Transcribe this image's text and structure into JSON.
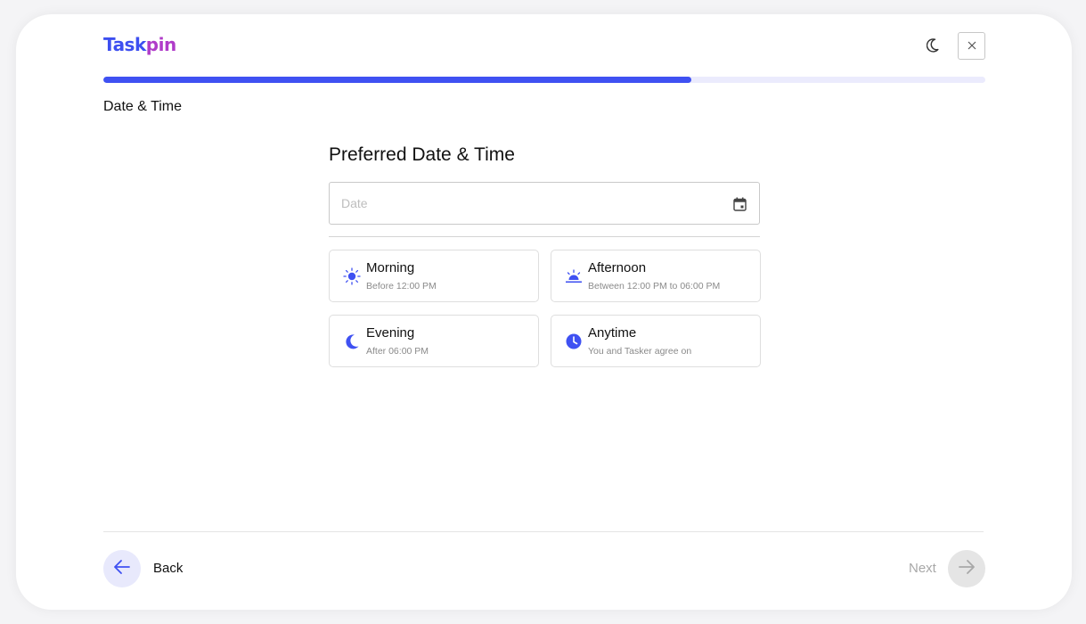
{
  "brand": {
    "logo_part1": "Task",
    "logo_part2": "pin",
    "color1": "#3d4ff0",
    "color2": "#b03cc9"
  },
  "header": {
    "theme_icon": "moon-icon",
    "close_icon": "close-icon"
  },
  "progress": {
    "value_fraction": 0.667,
    "fill_color": "#3f51f2",
    "track_color": "#ebebfd"
  },
  "step": {
    "label": "Date & Time"
  },
  "form": {
    "title": "Preferred Date & Time",
    "date_placeholder": "Date",
    "date_value": "",
    "calendar_icon": "calendar-icon"
  },
  "time_options": [
    {
      "title": "Morning",
      "subtitle": "Before 12:00 PM",
      "icon": "sun-icon"
    },
    {
      "title": "Afternoon",
      "subtitle": "Between 12:00 PM to 06:00 PM",
      "icon": "sunset-icon"
    },
    {
      "title": "Evening",
      "subtitle": "After 06:00 PM",
      "icon": "moon-icon"
    },
    {
      "title": "Anytime",
      "subtitle": "You and Tasker agree on",
      "icon": "clock-icon"
    }
  ],
  "footer": {
    "back_label": "Back",
    "next_label": "Next",
    "accent": "#3f51f2"
  }
}
